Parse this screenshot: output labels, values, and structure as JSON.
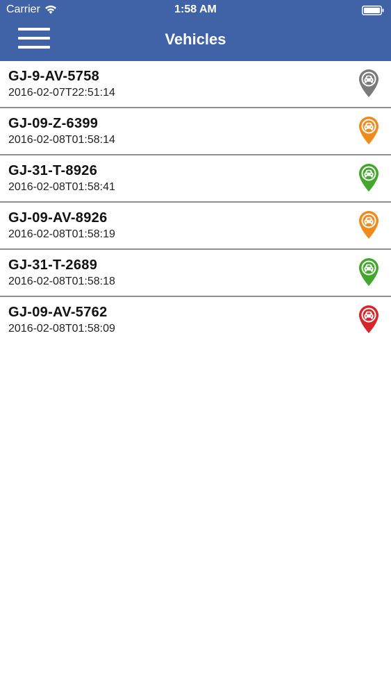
{
  "status_bar": {
    "carrier": "Carrier",
    "time": "1:58 AM"
  },
  "nav": {
    "title": "Vehicles",
    "menu_icon": "hamburger-menu-icon"
  },
  "vehicles": [
    {
      "plate": "GJ-9-AV-5758",
      "timestamp": "2016-02-07T22:51:14",
      "status_color": "#7a7a7a",
      "icon": "car-location-pin-icon"
    },
    {
      "plate": "GJ-09-Z-6399",
      "timestamp": "2016-02-08T01:58:14",
      "status_color": "#ef8a1c",
      "icon": "car-location-pin-icon"
    },
    {
      "plate": "GJ-31-T-8926",
      "timestamp": "2016-02-08T01:58:41",
      "status_color": "#43a62d",
      "icon": "car-location-pin-icon"
    },
    {
      "plate": "GJ-09-AV-8926",
      "timestamp": "2016-02-08T01:58:19",
      "status_color": "#ef8a1c",
      "icon": "car-location-pin-icon"
    },
    {
      "plate": "GJ-31-T-2689",
      "timestamp": "2016-02-08T01:58:18",
      "status_color": "#43a62d",
      "icon": "car-location-pin-icon"
    },
    {
      "plate": "GJ-09-AV-5762",
      "timestamp": "2016-02-08T01:58:09",
      "status_color": "#d6262b",
      "icon": "car-location-pin-icon"
    }
  ],
  "colors": {
    "nav_background": "#3f63a6",
    "row_divider": "#8e8e8e"
  }
}
